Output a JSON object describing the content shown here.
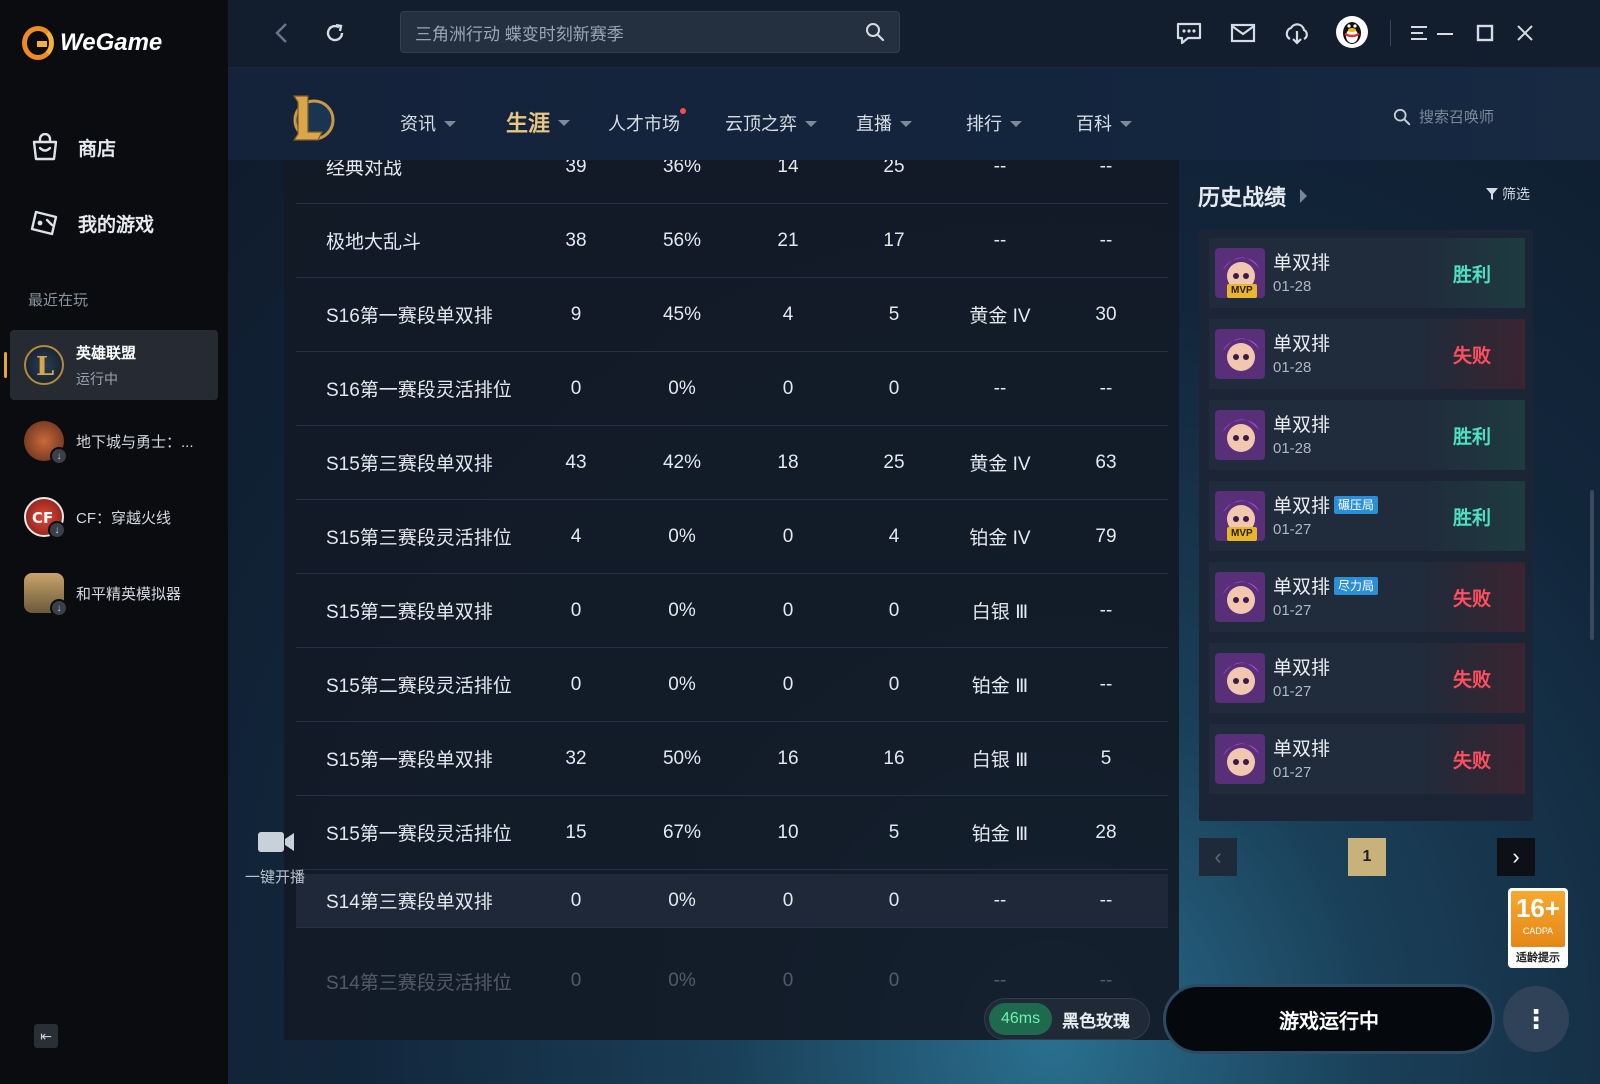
{
  "app": {
    "name": "WeGame"
  },
  "sidebar": {
    "nav": [
      {
        "label": "商店",
        "icon": "store-icon"
      },
      {
        "label": "我的游戏",
        "icon": "gamepad-icon"
      }
    ],
    "recent_label": "最近在玩",
    "recent": [
      {
        "name": "英雄联盟",
        "status": "运行中"
      },
      {
        "name": "地下城与勇士：...",
        "status": ""
      },
      {
        "name": "CF：穿越火线",
        "status": ""
      },
      {
        "name": "和平精英模拟器",
        "status": ""
      }
    ]
  },
  "topbar": {
    "search_value": "三角洲行动 蝶变时刻新赛季"
  },
  "gamenav": {
    "tabs": [
      {
        "label": "资讯"
      },
      {
        "label": "生涯"
      },
      {
        "label": "人才市场"
      },
      {
        "label": "云顶之弈"
      },
      {
        "label": "直播"
      },
      {
        "label": "排行"
      },
      {
        "label": "百科"
      }
    ],
    "summoner_search_placeholder": "搜索召唤师"
  },
  "stats": {
    "rows": [
      {
        "mode": "经典对战",
        "games": "39",
        "winrate": "36%",
        "wins": "14",
        "losses": "25",
        "rank": "--",
        "points": "--"
      },
      {
        "mode": "极地大乱斗",
        "games": "38",
        "winrate": "56%",
        "wins": "21",
        "losses": "17",
        "rank": "--",
        "points": "--"
      },
      {
        "mode": "S16第一赛段单双排",
        "games": "9",
        "winrate": "45%",
        "wins": "4",
        "losses": "5",
        "rank": "黄金 IV",
        "points": "30"
      },
      {
        "mode": "S16第一赛段灵活排位",
        "games": "0",
        "winrate": "0%",
        "wins": "0",
        "losses": "0",
        "rank": "--",
        "points": "--"
      },
      {
        "mode": "S15第三赛段单双排",
        "games": "43",
        "winrate": "42%",
        "wins": "18",
        "losses": "25",
        "rank": "黄金 IV",
        "points": "63"
      },
      {
        "mode": "S15第三赛段灵活排位",
        "games": "4",
        "winrate": "0%",
        "wins": "0",
        "losses": "4",
        "rank": "铂金 IV",
        "points": "79"
      },
      {
        "mode": "S15第二赛段单双排",
        "games": "0",
        "winrate": "0%",
        "wins": "0",
        "losses": "0",
        "rank": "白银 Ⅲ",
        "points": "--"
      },
      {
        "mode": "S15第二赛段灵活排位",
        "games": "0",
        "winrate": "0%",
        "wins": "0",
        "losses": "0",
        "rank": "铂金 Ⅲ",
        "points": "--"
      },
      {
        "mode": "S15第一赛段单双排",
        "games": "32",
        "winrate": "50%",
        "wins": "16",
        "losses": "16",
        "rank": "白银 Ⅲ",
        "points": "5"
      },
      {
        "mode": "S15第一赛段灵活排位",
        "games": "15",
        "winrate": "67%",
        "wins": "10",
        "losses": "5",
        "rank": "铂金 Ⅲ",
        "points": "28"
      },
      {
        "mode": "S14第三赛段单双排",
        "games": "0",
        "winrate": "0%",
        "wins": "0",
        "losses": "0",
        "rank": "--",
        "points": "--"
      },
      {
        "mode": "S14第三赛段灵活排位",
        "games": "0",
        "winrate": "0%",
        "wins": "0",
        "losses": "0",
        "rank": "--",
        "points": "--"
      }
    ]
  },
  "broadcast": {
    "label": "一键开播"
  },
  "history": {
    "title": "历史战绩",
    "filter_label": "筛选",
    "matches": [
      {
        "mode": "单双排",
        "date": "01-28",
        "result": "胜利",
        "win": true,
        "mvp": "MVP",
        "tag": ""
      },
      {
        "mode": "单双排",
        "date": "01-28",
        "result": "失败",
        "win": false,
        "mvp": "",
        "tag": ""
      },
      {
        "mode": "单双排",
        "date": "01-28",
        "result": "胜利",
        "win": true,
        "mvp": "",
        "tag": ""
      },
      {
        "mode": "单双排",
        "date": "01-27",
        "result": "胜利",
        "win": true,
        "mvp": "MVP",
        "tag": "碾压局"
      },
      {
        "mode": "单双排",
        "date": "01-27",
        "result": "失败",
        "win": false,
        "mvp": "",
        "tag": "尽力局"
      },
      {
        "mode": "单双排",
        "date": "01-27",
        "result": "失败",
        "win": false,
        "mvp": "",
        "tag": ""
      },
      {
        "mode": "单双排",
        "date": "01-27",
        "result": "失败",
        "win": false,
        "mvp": "",
        "tag": ""
      }
    ],
    "page": "1"
  },
  "age_rating": {
    "age": "16+",
    "org": "CADPA",
    "label": "适龄提示"
  },
  "bottom": {
    "ping": "46ms",
    "server": "黑色玫瑰",
    "run_label": "游戏运行中"
  },
  "colors": {
    "accent": "#e9c783",
    "win": "#4fe0c0",
    "lose": "#ff4f5e",
    "ping": "#6ff0b2"
  }
}
